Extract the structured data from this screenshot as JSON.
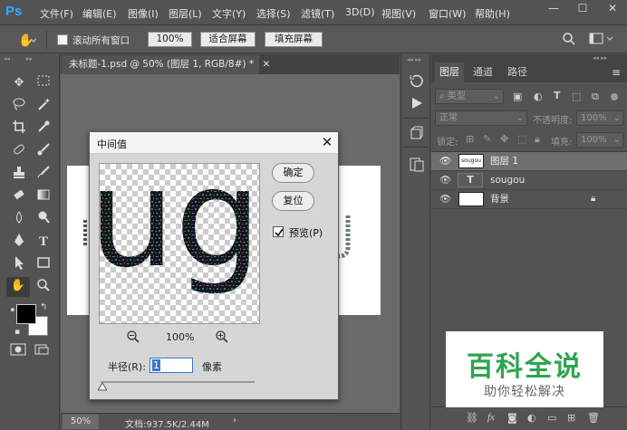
{
  "app": {
    "logo": "Ps",
    "menu": [
      "文件(F)",
      "编辑(E)",
      "图像(I)",
      "图层(L)",
      "文字(Y)",
      "选择(S)",
      "滤镜(T)",
      "3D(D)",
      "视图(V)",
      "窗口(W)",
      "帮助(H)"
    ],
    "window_controls": {
      "minimize": "—",
      "maximize": "☐",
      "close": "✕"
    }
  },
  "options_bar": {
    "scroll_all_label": "滚动所有窗口",
    "zoom_value": "100%",
    "fit_screen": "适合屏幕",
    "fill_screen": "填充屏幕"
  },
  "document": {
    "tab_title": "未标题-1.psd @ 50% (图层 1, RGB/8#) *",
    "zoom": "50%",
    "doc_info": "文档:937.5K/2.44M"
  },
  "dialog": {
    "title": "中间值",
    "ok": "确定",
    "reset": "复位",
    "preview_label": "预览(P)",
    "preview_checked": true,
    "preview_zoom": "100%",
    "radius_label": "半径(R):",
    "radius_value": "1",
    "radius_unit": "像素",
    "preview_text": "ug"
  },
  "layers_panel": {
    "tabs": [
      "图层",
      "通道",
      "路径"
    ],
    "filter_placeholder": "类型",
    "blend_mode": "正常",
    "opacity_label": "不透明度:",
    "opacity_value": "100%",
    "lock_label": "锁定:",
    "fill_label": "填充:",
    "fill_value": "100%",
    "layers": [
      {
        "name": "图层 1",
        "thumb": "sougou",
        "selected": true,
        "locked": false
      },
      {
        "name": "sougou",
        "thumb": "",
        "selected": false,
        "locked": false
      },
      {
        "name": "背景",
        "thumb": "",
        "selected": false,
        "locked": true
      }
    ]
  },
  "watermark": {
    "title": "百科全说",
    "subtitle": "助你轻松解决"
  },
  "colors": {
    "ps_blue": "#31a8ff",
    "ui_dark": "#535353",
    "selected_layer": "#6f6f6f",
    "watermark_green": "#2ea44f"
  }
}
